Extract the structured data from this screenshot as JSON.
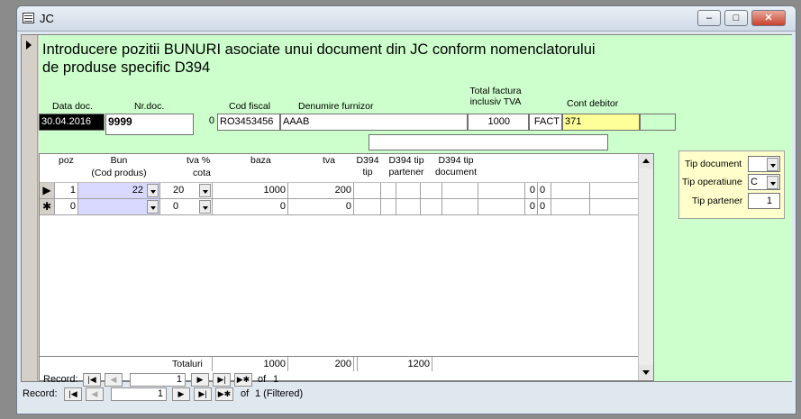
{
  "window": {
    "title": "JC"
  },
  "form": {
    "heading_line1": "Introducere pozitii BUNURI asociate unui document din JC conform nomenclatorului",
    "heading_line2": "de produse specific D394"
  },
  "header_labels": {
    "data_doc": "Data doc.",
    "nr_doc": "Nr.doc.",
    "cod_fiscal": "Cod fiscal",
    "denumire_furnizor": "Denumire furnizor",
    "total_factura_1": "Total factura",
    "total_factura_2": "inclusiv TVA",
    "cont_debitor": "Cont debitor"
  },
  "header_values": {
    "data_doc": "30.04.2016",
    "nr_doc": "9999",
    "zero": "0",
    "cod_fiscal": "RO3453456",
    "denumire_furnizor": "AAAB",
    "total_factura": "1000",
    "tip": "FACT",
    "cont_debitor": "371"
  },
  "grid": {
    "columns": {
      "poz": "poz",
      "bun_1": "Bun",
      "bun_2": "(Cod produs)",
      "tva_1": "tva %",
      "tva_2": "cota",
      "baza": "baza",
      "tva": "tva",
      "d394tip_1": "D394",
      "d394tip_2": "tip",
      "d394part_1": "D394 tip",
      "d394part_2": "partener",
      "d394doc_1": "D394 tip",
      "d394doc_2": "document"
    },
    "rows": [
      {
        "selector": "▶",
        "poz": "1",
        "bun": "22",
        "cota": "20",
        "baza": "1000",
        "tva": "200",
        "z1": "0",
        "z2": "0"
      },
      {
        "selector": "✱",
        "poz": "0",
        "bun": "",
        "cota": "0",
        "baza": "0",
        "tva": "0",
        "z1": "0",
        "z2": "0"
      }
    ],
    "totals": {
      "label": "Totaluri",
      "baza": "1000",
      "tva": "200",
      "total": "1200"
    }
  },
  "sub_nav": {
    "label": "Record:",
    "current": "1",
    "of_label": "of",
    "total": "1"
  },
  "main_nav": {
    "label": "Record:",
    "current": "1",
    "of_label": "of",
    "total": "1 (Filtered)"
  },
  "side_panel": {
    "tip_document_label": "Tip document",
    "tip_document_value": "",
    "tip_operatiune_label": "Tip operatiune",
    "tip_operatiune_value": "C",
    "tip_partener_label": "Tip partener",
    "tip_partener_value": "1"
  }
}
